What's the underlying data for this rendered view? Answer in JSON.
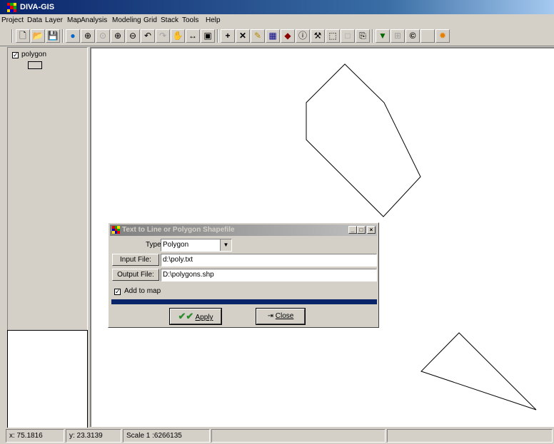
{
  "app": {
    "title": "DIVA-GIS"
  },
  "menu": [
    "Project",
    "Data",
    "Layer",
    "Map",
    "Analysis",
    "Modeling",
    "Grid",
    "Stack",
    "Tools",
    "Help"
  ],
  "toolbar": {
    "icons": [
      "new-file-icon",
      "open-folder-icon",
      "save-icon",
      "globe-icon",
      "zoom-full-extent-icon",
      "zoom-layer-icon",
      "zoom-in-icon",
      "zoom-out-icon",
      "undo-zoom-icon",
      "redo-zoom-icon",
      "pan-hand-icon",
      "measure-distance-icon",
      "map-select-icon",
      "add-point-icon",
      "delete-icon",
      "pencil-icon",
      "table-icon",
      "query-icon",
      "info-icon",
      "tool-icon",
      "select-rect-icon",
      "clear-selection-icon",
      "export-icon",
      "layer-style-icon",
      "grid-icon",
      "copyright-icon",
      "blank-icon",
      "sun-icon"
    ]
  },
  "legend": {
    "layer_name": "polygon",
    "checked": true
  },
  "dialog": {
    "title": "Text to Line or Polygon Shapefile",
    "type_label": "Type",
    "type_value": "Polygon",
    "input_button": "Input File:",
    "input_value": "d:\\poly.txt",
    "output_button": "Output File:",
    "output_value": "D:\\polygons.shp",
    "add_to_map_label": "Add to map",
    "add_to_map_checked": true,
    "apply_label": "Apply",
    "close_label": "Close",
    "window_buttons": [
      "_",
      "□",
      "×"
    ]
  },
  "status": {
    "x": "x: 75.1816",
    "y": "y: 23.3139",
    "scale": "Scale 1 :6266135"
  },
  "colors": {
    "titlebar": "#0a246a",
    "progress": "#0a246a",
    "apply_check": "#2e8b2e"
  }
}
